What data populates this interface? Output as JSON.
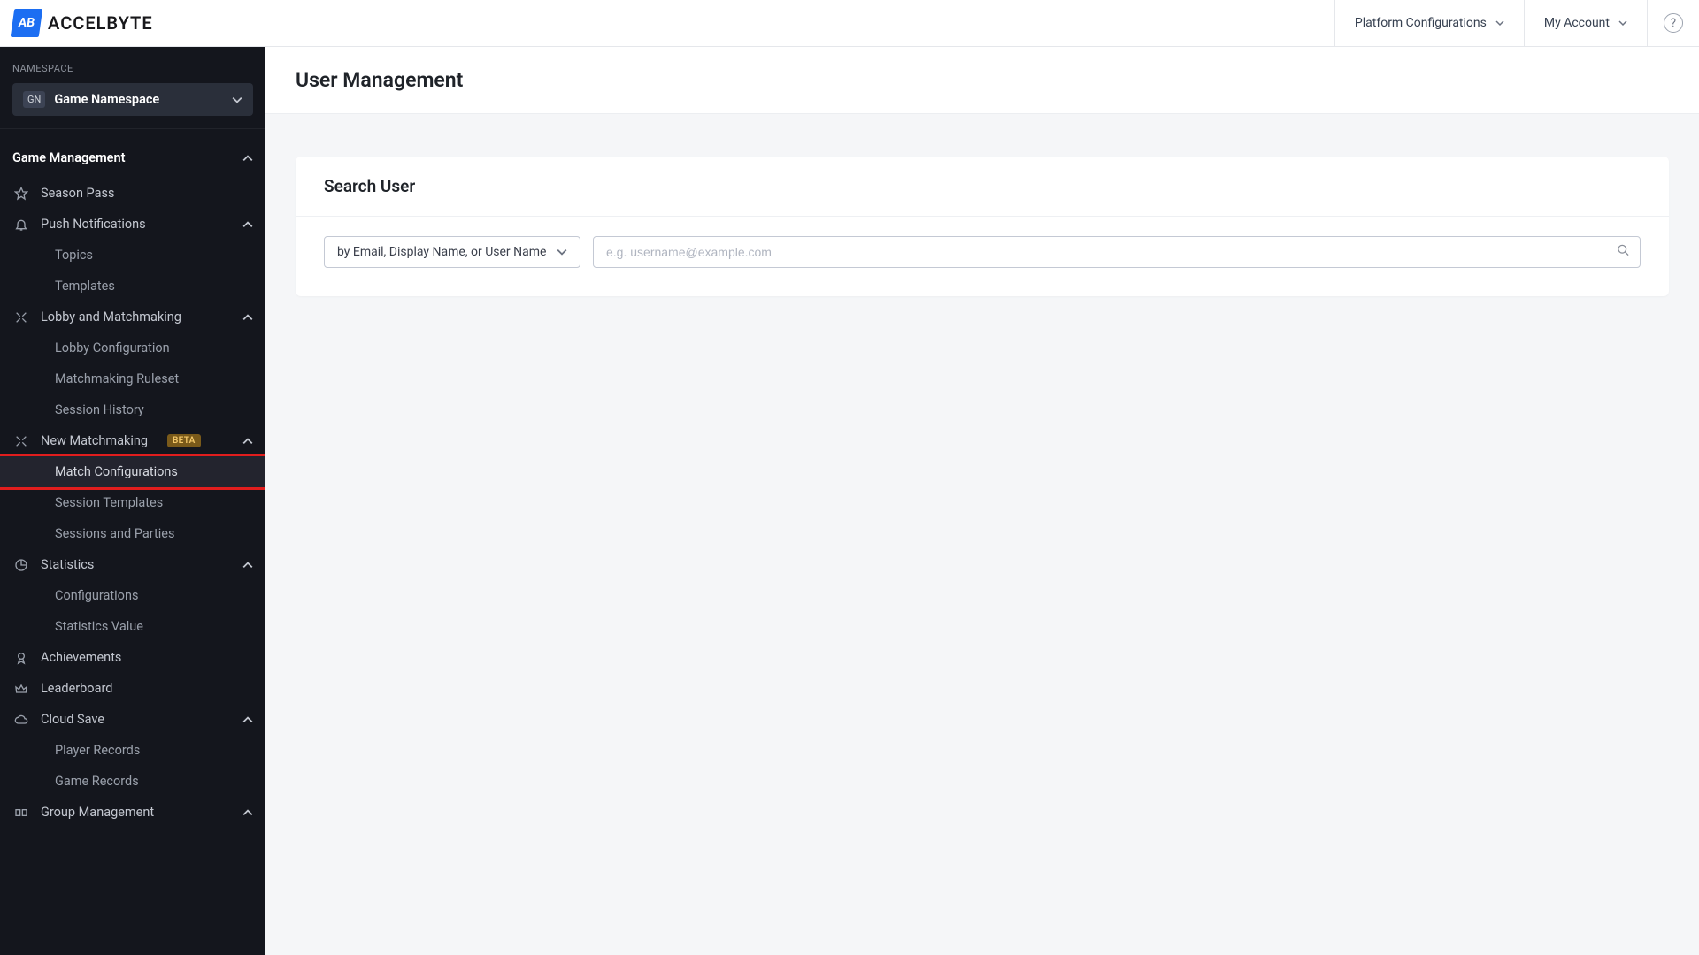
{
  "brand": {
    "mark_text": "AB",
    "word": "ACCELBYTE"
  },
  "header": {
    "platform_configurations": "Platform Configurations",
    "my_account": "My Account"
  },
  "sidebar": {
    "namespace_label": "NAMESPACE",
    "namespace_badge": "GN",
    "namespace_name": "Game Namespace",
    "section_title": "Game Management",
    "items": {
      "season_pass": "Season Pass",
      "push_notifications": "Push Notifications",
      "topics": "Topics",
      "templates": "Templates",
      "lobby_matchmaking": "Lobby and Matchmaking",
      "lobby_configuration": "Lobby Configuration",
      "matchmaking_ruleset": "Matchmaking Ruleset",
      "session_history": "Session History",
      "new_matchmaking": "New Matchmaking",
      "beta": "BETA",
      "match_configurations": "Match Configurations",
      "session_templates": "Session Templates",
      "sessions_parties": "Sessions and Parties",
      "statistics": "Statistics",
      "configurations": "Configurations",
      "statistics_value": "Statistics Value",
      "achievements": "Achievements",
      "leaderboard": "Leaderboard",
      "cloud_save": "Cloud Save",
      "player_records": "Player Records",
      "game_records": "Game Records",
      "group_management": "Group Management"
    }
  },
  "page": {
    "title": "User Management"
  },
  "search_card": {
    "title": "Search User",
    "filter_label": "by Email, Display Name, or User Name",
    "placeholder": "e.g. username@example.com"
  }
}
